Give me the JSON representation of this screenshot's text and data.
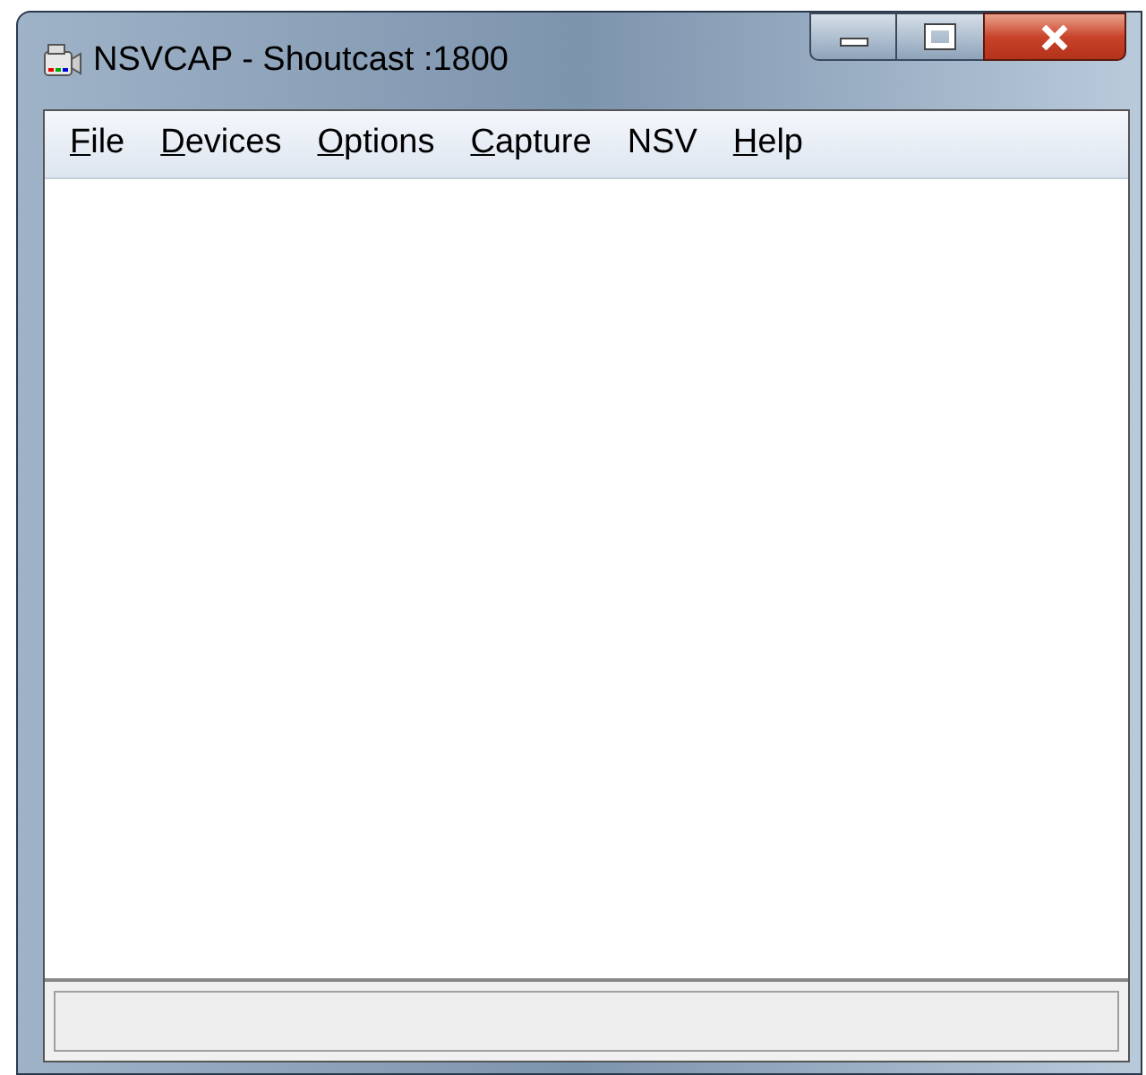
{
  "window": {
    "title": "NSVCAP - Shoutcast :1800"
  },
  "menu": [
    {
      "underlined": "F",
      "rest": "ile"
    },
    {
      "underlined": "D",
      "rest": "evices"
    },
    {
      "underlined": "O",
      "rest": "ptions"
    },
    {
      "underlined": "C",
      "rest": "apture"
    },
    {
      "rest": "NSV"
    },
    {
      "underlined": "H",
      "rest": "elp"
    }
  ]
}
